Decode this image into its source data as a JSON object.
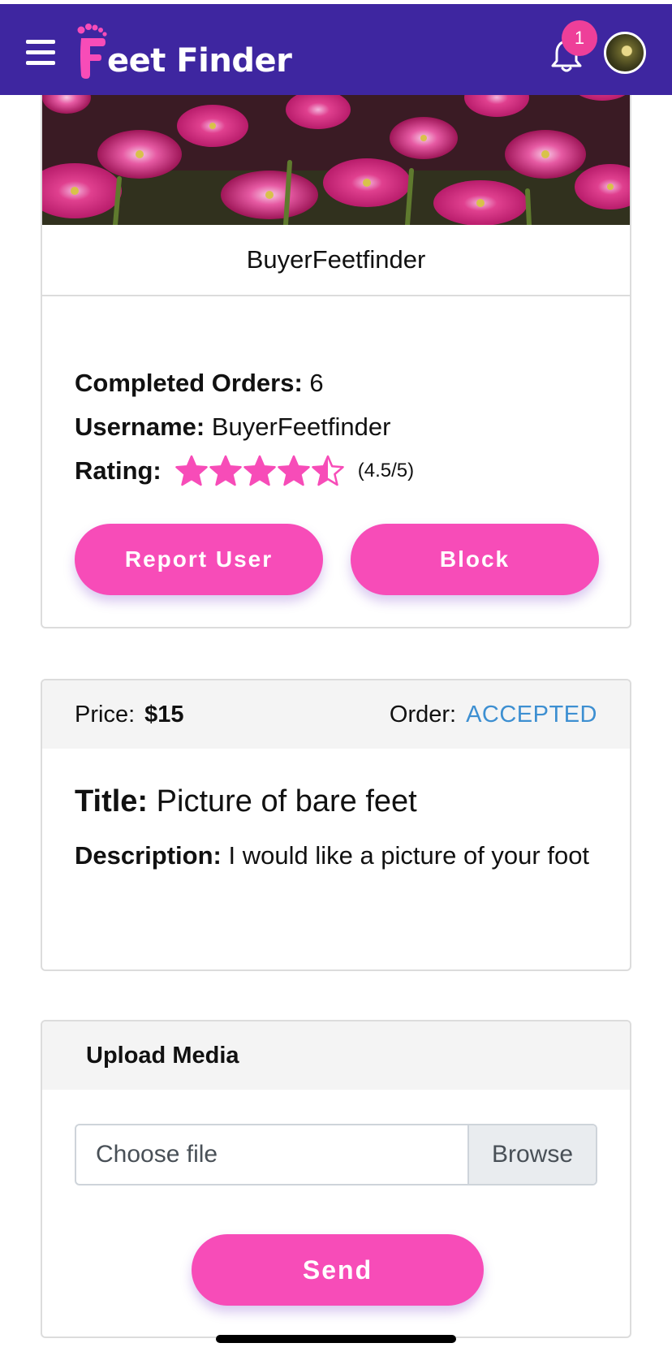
{
  "header": {
    "logo_text": "eet Finder",
    "logo_letter": "F",
    "notification_count": "1",
    "icons": [
      "hamburger-menu-icon",
      "foot-logo-icon",
      "bell-icon",
      "avatar"
    ],
    "colors": {
      "bar": "#3e26a0",
      "accent": "#f74cb8"
    }
  },
  "profile": {
    "name": "BuyerFeetfinder",
    "completed_orders_label": "Completed Orders:",
    "completed_orders_value": "6",
    "username_label": "Username:",
    "username_value": "BuyerFeetfinder",
    "rating_label": "Rating:",
    "rating_value": 4.5,
    "rating_text": "(4.5/5)",
    "report_button": "Report User",
    "block_button": "Block"
  },
  "order": {
    "price_label": "Price:",
    "price_value": "$15",
    "status_label": "Order:",
    "status_value": "ACCEPTED",
    "title_label": "Title:",
    "title_value": "Picture of bare feet",
    "description_label": "Description:",
    "description_value": "I would like a picture of your foot"
  },
  "upload": {
    "heading": "Upload Media",
    "file_placeholder": "Choose file",
    "browse_label": "Browse",
    "send_button": "Send"
  }
}
